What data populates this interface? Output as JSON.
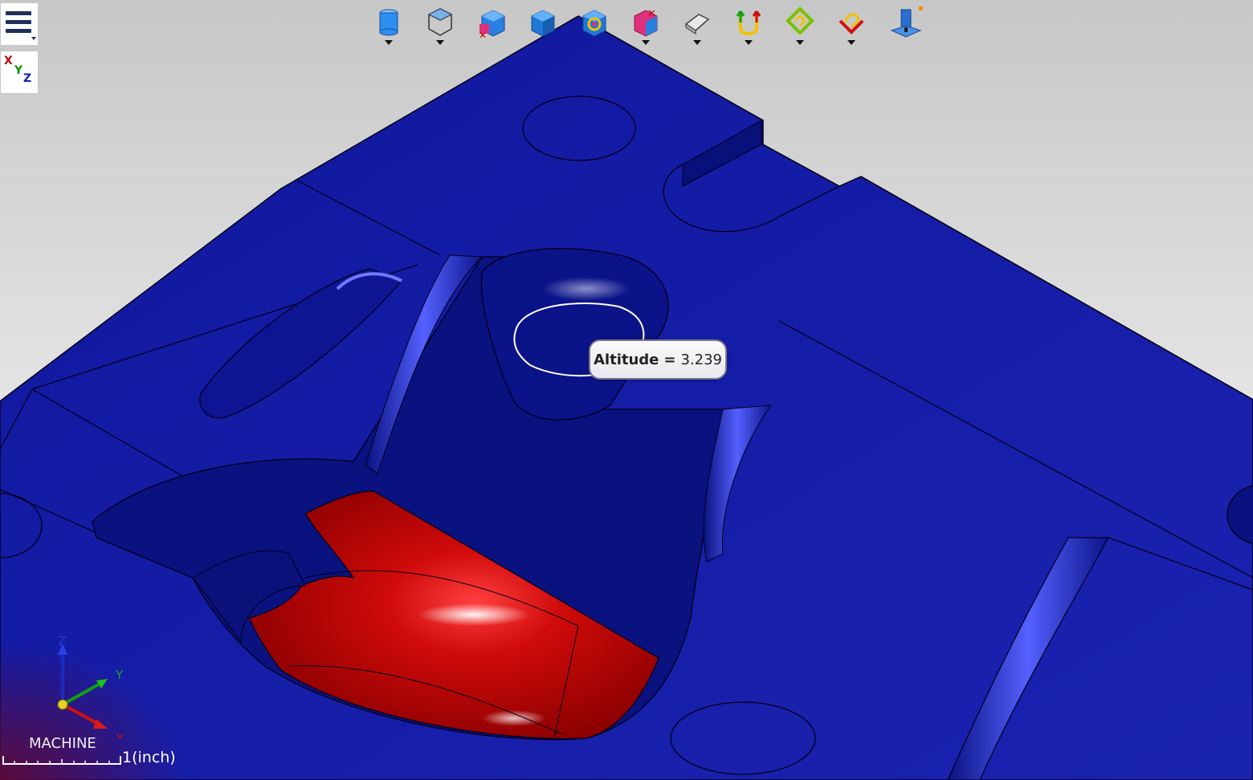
{
  "toolbar": {
    "items": [
      {
        "icon": "cylinder-stock-icon",
        "has_dropdown": true
      },
      {
        "icon": "wireframe-box-icon",
        "has_dropdown": true
      },
      {
        "icon": "remove-stock-icon",
        "has_dropdown": false
      },
      {
        "icon": "solid-box-icon",
        "has_dropdown": false
      },
      {
        "icon": "refresh-stock-icon",
        "has_dropdown": false
      },
      {
        "icon": "delete-part-icon",
        "has_dropdown": true
      },
      {
        "icon": "eraser-icon",
        "has_dropdown": true
      },
      {
        "icon": "axes-arrows-icon",
        "has_dropdown": true
      },
      {
        "icon": "toolpath-diamond-icon",
        "has_dropdown": true
      },
      {
        "icon": "toolpath-flip-icon",
        "has_dropdown": true
      },
      {
        "icon": "machine-tool-icon",
        "has_dropdown": false
      }
    ]
  },
  "side": {
    "menu_icon": "hamburger-menu-icon",
    "axes_labels": [
      "X",
      "Y",
      "Z"
    ]
  },
  "tooltip": {
    "label": "Altitude",
    "equals": "=",
    "value": "3.239"
  },
  "triad": {
    "x_label": "X",
    "y_label": "Y",
    "z_label": "Z"
  },
  "footer": {
    "cs_label": "MACHINE",
    "scale_label": "1(inch)"
  },
  "colors": {
    "part": "#1219a8",
    "highlight": "#c30808",
    "edge": "#000018"
  }
}
